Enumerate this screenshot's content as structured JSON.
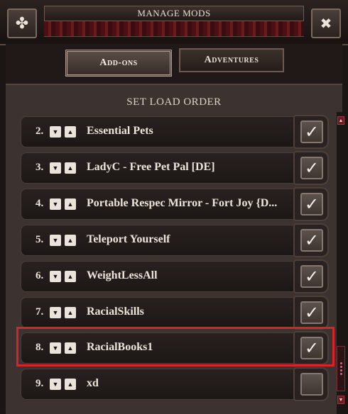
{
  "header": {
    "title": "MANAGE MODS",
    "left_icon": "puzzle-piece-icon",
    "right_icon": "close-icon",
    "close_glyph": "✖",
    "puzzle_glyph": "✤"
  },
  "tabs": [
    {
      "label": "Add-ons",
      "active": true
    },
    {
      "label": "Adventures",
      "active": false
    }
  ],
  "section_title": "SET LOAD ORDER",
  "mods": [
    {
      "num": "2.",
      "name": "Essential Pets",
      "enabled": true
    },
    {
      "num": "3.",
      "name": "LadyC - Free Pet Pal [DE]",
      "enabled": true
    },
    {
      "num": "4.",
      "name": "Portable Respec Mirror - Fort Joy {D...",
      "enabled": true
    },
    {
      "num": "5.",
      "name": "Teleport Yourself",
      "enabled": true
    },
    {
      "num": "6.",
      "name": "WeightLessAll",
      "enabled": true
    },
    {
      "num": "7.",
      "name": "RacialSkills",
      "enabled": true
    },
    {
      "num": "8.",
      "name": "RacialBooks1",
      "enabled": true,
      "highlighted": true
    },
    {
      "num": "9.",
      "name": "xd",
      "enabled": false
    }
  ],
  "glyphs": {
    "down": "▼",
    "up": "▲",
    "check": "✓"
  },
  "colors": {
    "highlight": "#d9222a",
    "scroll_accent": "#6a1a1f"
  }
}
